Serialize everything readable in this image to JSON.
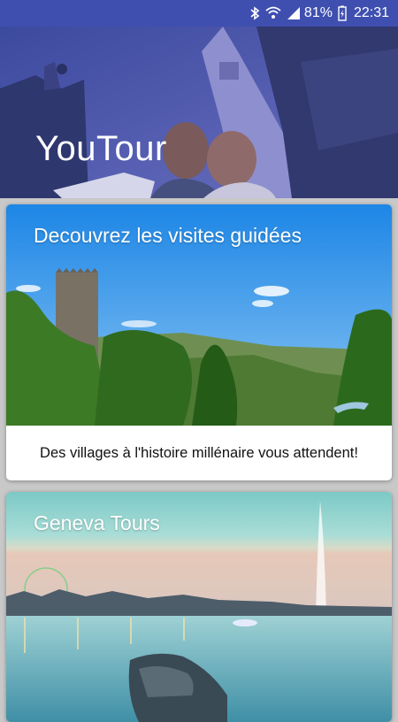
{
  "status_bar": {
    "battery": "81%",
    "time": "22:31",
    "icons": [
      "bluetooth-icon",
      "wifi-icon",
      "signal-icon",
      "battery-charging-icon"
    ]
  },
  "header": {
    "title": "YouTour"
  },
  "cards": [
    {
      "title": "Decouvrez les visites guidées",
      "description": "Des villages à l'histoire millénaire vous attendent!"
    },
    {
      "title": "Geneva Tours"
    }
  ],
  "colors": {
    "status_bar": "#3f4fb0",
    "header_tint": "#4656b8",
    "background": "#c8c8c8"
  }
}
